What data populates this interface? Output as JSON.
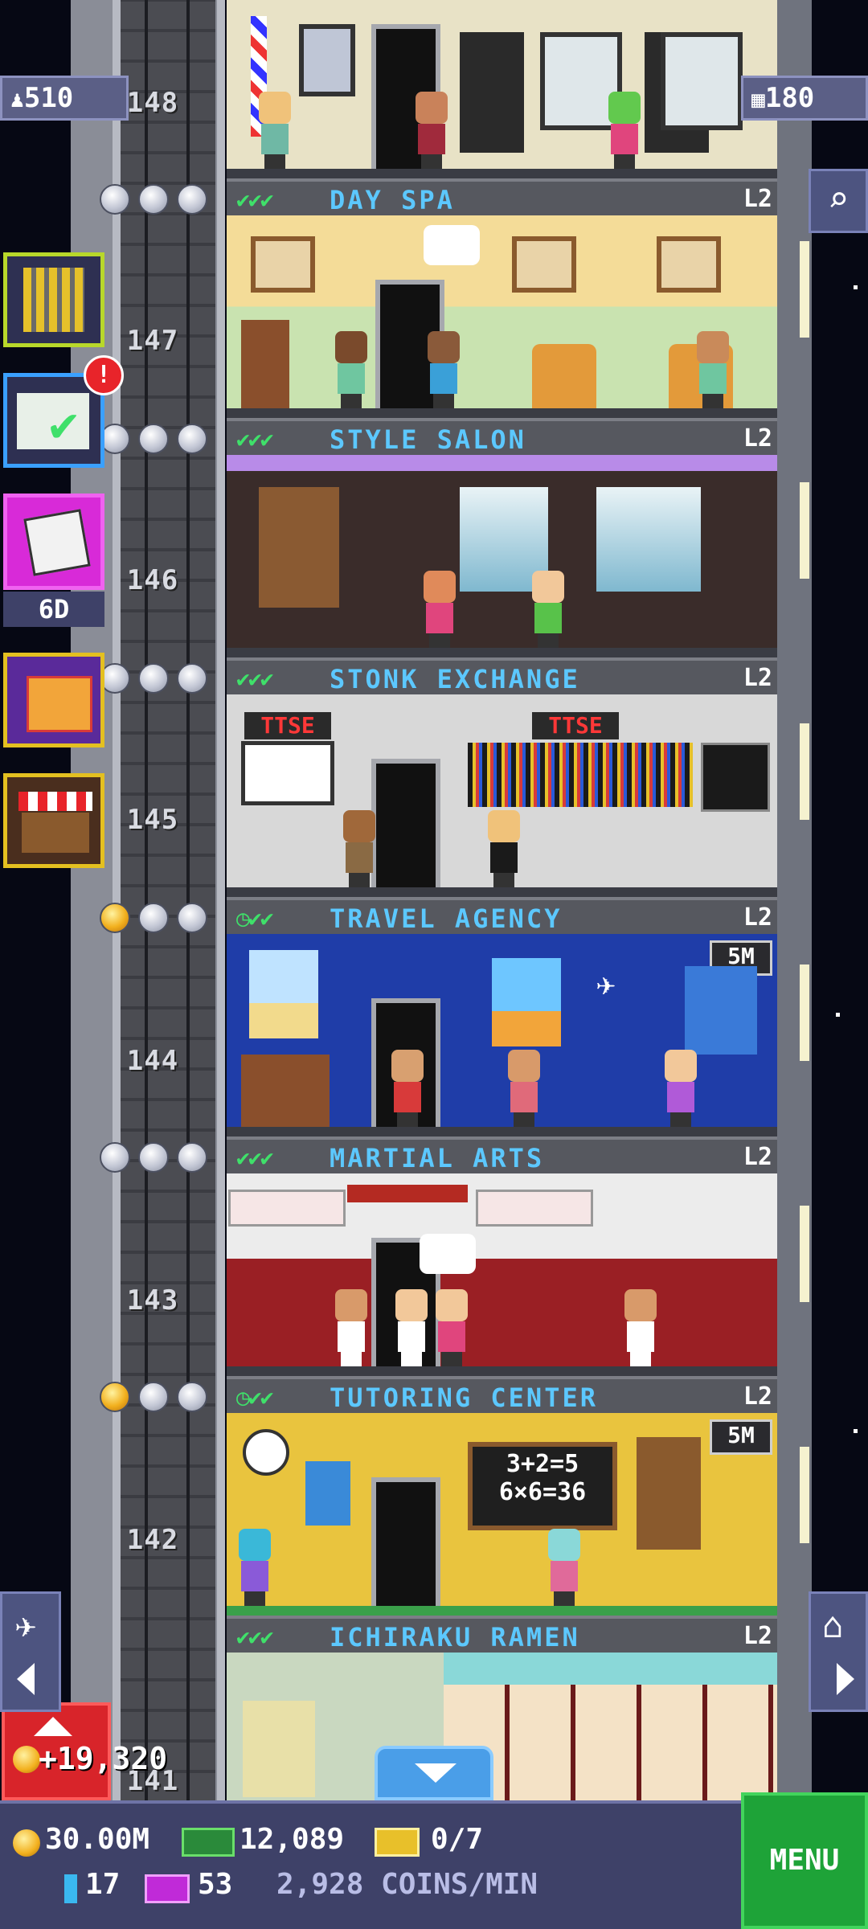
{
  "hud": {
    "population": "510",
    "floors_count": "180"
  },
  "sidebar": {
    "dice_timer": "6D"
  },
  "floors": [
    {
      "number": "148",
      "name": "",
      "level": "",
      "stars": "",
      "checks": ""
    },
    {
      "number": "147",
      "name": "DAY SPA",
      "level": "L2",
      "checks": "✔✔✔"
    },
    {
      "number": "146",
      "name": "STYLE SALON",
      "level": "L2",
      "checks": "✔✔✔"
    },
    {
      "number": "145",
      "name": "STONK EXCHANGE",
      "level": "L2",
      "checks": "✔✔✔",
      "signs": [
        "TTSE",
        "TTSE"
      ]
    },
    {
      "number": "144",
      "name": "TRAVEL AGENCY",
      "level": "L2",
      "checks": "◷✔✔",
      "badge": "5M"
    },
    {
      "number": "143",
      "name": "MARTIAL ARTS",
      "level": "L2",
      "checks": "✔✔✔"
    },
    {
      "number": "142",
      "name": "TUTORING CENTER",
      "level": "L2",
      "checks": "◷✔✔",
      "badge": "5M",
      "chalkboard": [
        "3+2=5",
        "6×6=36"
      ]
    },
    {
      "number": "141",
      "name": "ICHIRAKU RAMEN",
      "level": "L2",
      "checks": "✔✔✔"
    }
  ],
  "floor_reward": "+19,320",
  "bottom": {
    "coins": "30.00M",
    "bux": "12,089",
    "vip_tickets": "0/7",
    "keys": "17",
    "golden_tickets": "53",
    "rate": "2,928 COINS/MIN",
    "menu_label": "MENU"
  },
  "colors": {
    "banner_text": "#5cc8ff",
    "check_green": "#3fe06a",
    "menu_green": "#1ea338",
    "hud_purple": "#5b5f86"
  }
}
